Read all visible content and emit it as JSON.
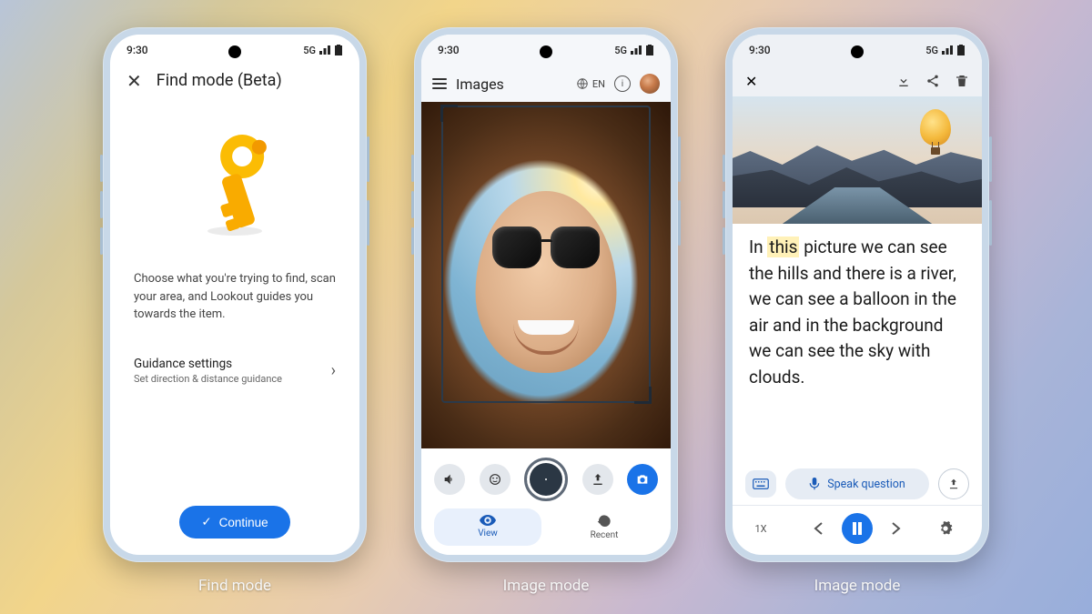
{
  "status": {
    "time": "9:30",
    "network": "5G"
  },
  "captions": {
    "p1": "Find mode",
    "p2": "Image mode",
    "p3": "Image mode"
  },
  "phone1": {
    "title": "Find mode (Beta)",
    "description": "Choose what you're trying to find, scan your area, and Lookout guides you towards the item.",
    "settings_title": "Guidance settings",
    "settings_sub": "Set direction & distance guidance",
    "continue": "Continue"
  },
  "phone2": {
    "header_title": "Images",
    "lang": "EN",
    "tab_view": "View",
    "tab_recent": "Recent"
  },
  "phone3": {
    "text_pre": "In ",
    "text_hl": "this",
    "text_post": " picture we can see the hills and there is a river, we can see a balloon in the air and in the background we can see the sky with clouds.",
    "speak": "Speak question",
    "speed": "1X"
  }
}
